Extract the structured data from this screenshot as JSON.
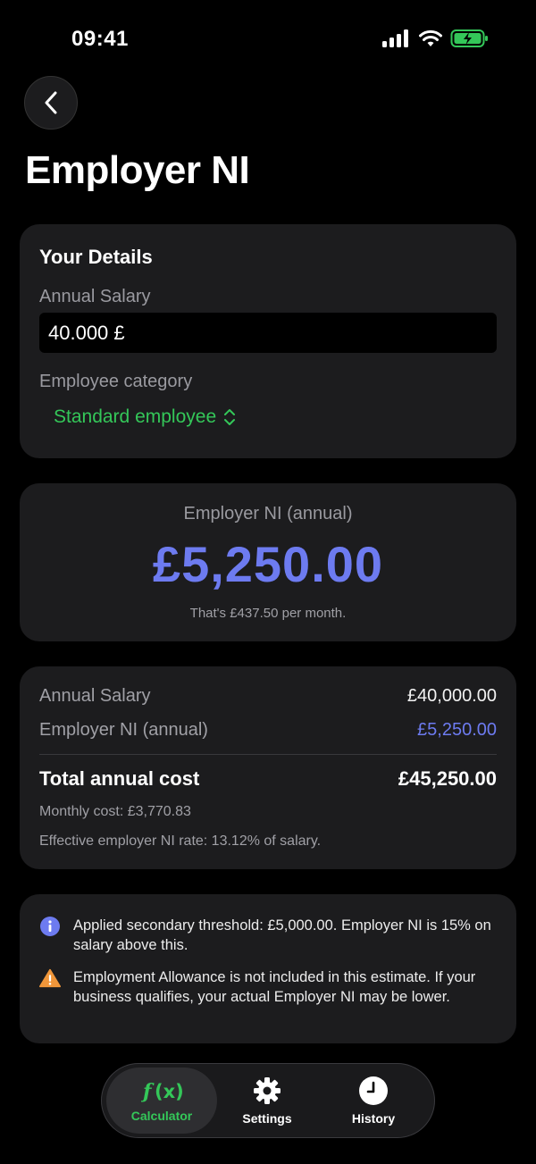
{
  "status": {
    "time": "09:41"
  },
  "header": {
    "title": "Employer NI"
  },
  "details": {
    "title": "Your Details",
    "salary_label": "Annual Salary",
    "salary_value": "40.000 £",
    "category_label": "Employee category",
    "category_value": "Standard employee"
  },
  "result": {
    "label": "Employer NI (annual)",
    "value": "£5,250.00",
    "monthly_note": "That's £437.50 per month."
  },
  "breakdown": {
    "rows": [
      {
        "label": "Annual Salary",
        "value": "£40,000.00"
      },
      {
        "label": "Employer NI (annual)",
        "value": "£5,250.00"
      }
    ],
    "total_label": "Total annual cost",
    "total_value": "£45,250.00",
    "monthly_cost": "Monthly cost: £3,770.83",
    "effective_rate": "Effective employer NI rate: 13.12% of salary."
  },
  "info": {
    "threshold_note": "Applied secondary threshold: £5,000.00. Employer NI is 15% on salary above this.",
    "allowance_warning": "Employment Allowance is not included in this estimate. If your business qualifies, your actual Employer NI may be lower."
  },
  "tabs": [
    {
      "label": "Calculator",
      "icon": "function-icon",
      "active": true
    },
    {
      "label": "Settings",
      "icon": "gear-icon",
      "active": false
    },
    {
      "label": "History",
      "icon": "clock-icon",
      "active": false
    }
  ],
  "colors": {
    "accent_green": "#34c759",
    "accent_blue": "#6d7bf0",
    "warning": "#f0963a",
    "card": "#1c1c1e"
  }
}
